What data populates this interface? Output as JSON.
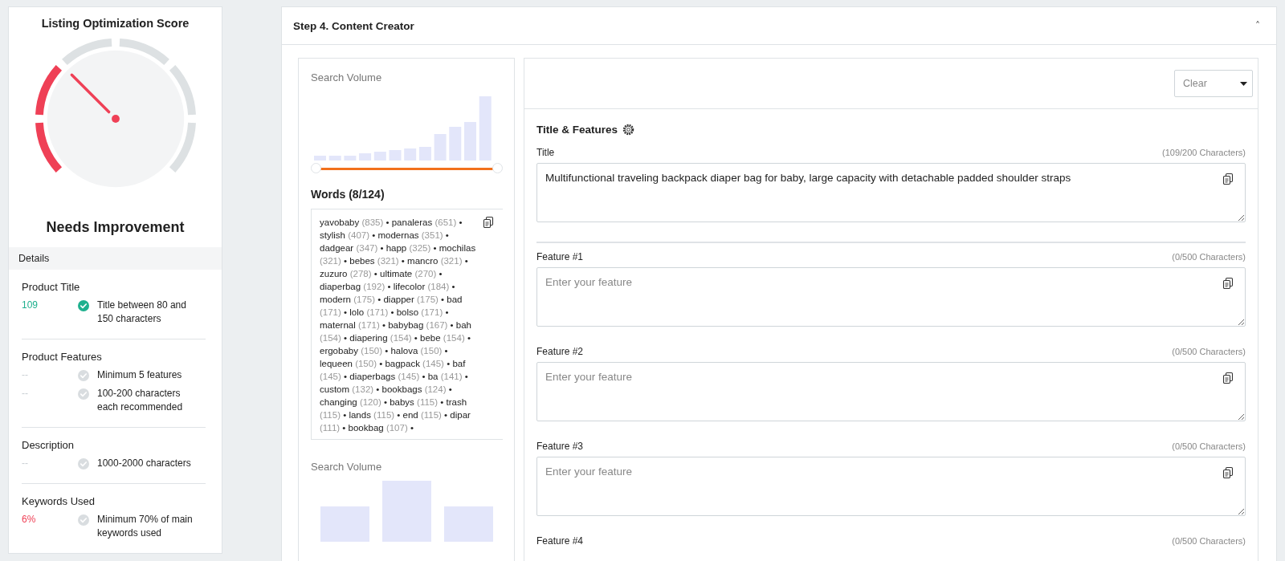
{
  "score_panel": {
    "title": "Listing Optimization Score",
    "gauge": {
      "segments": [
        {
          "filled": true
        },
        {
          "filled": true
        },
        {
          "filled": false
        },
        {
          "filled": false
        },
        {
          "filled": false
        },
        {
          "filled": false
        }
      ]
    },
    "verdict": "Needs Improvement",
    "details_heading": "Details",
    "groups": [
      {
        "title": "Product Title",
        "rows": [
          {
            "value": "109",
            "color": "#1fb08e",
            "checked": true,
            "requirement": "Title between 80 and 150 characters"
          }
        ]
      },
      {
        "title": "Product Features",
        "rows": [
          {
            "value": "--",
            "color": "#c9ced3",
            "checked": false,
            "requirement": "Minimum 5 features"
          },
          {
            "value": "--",
            "color": "#c9ced3",
            "checked": false,
            "requirement": "100-200 characters each recommended"
          }
        ]
      },
      {
        "title": "Description",
        "rows": [
          {
            "value": "--",
            "color": "#c9ced3",
            "checked": false,
            "requirement": "1000-2000 characters"
          }
        ]
      },
      {
        "title": "Keywords Used",
        "rows": [
          {
            "value": "6%",
            "color": "#ef4056",
            "checked": false,
            "requirement": "Minimum 70% of main keywords used"
          }
        ]
      }
    ]
  },
  "step": {
    "title": "Step 4. Content Creator",
    "expanded": true,
    "chevron": "˄"
  },
  "keywords_panel": {
    "chart_label": "Search Volume",
    "words_heading": "Words (8/124)",
    "separator": "•",
    "second_chart_label": "Search Volume",
    "words": [
      {
        "word": "yavobaby",
        "count": "(835)"
      },
      {
        "word": "panaleras",
        "count": "(651)"
      },
      {
        "word": "stylish",
        "count": "(407)"
      },
      {
        "word": "modernas",
        "count": "(351)"
      },
      {
        "word": "dadgear",
        "count": "(347)"
      },
      {
        "word": "happ",
        "count": "(325)"
      },
      {
        "word": "mochilas",
        "count": "(321)"
      },
      {
        "word": "bebes",
        "count": "(321)"
      },
      {
        "word": "mancro",
        "count": "(321)"
      },
      {
        "word": "zuzuro",
        "count": "(278)"
      },
      {
        "word": "ultimate",
        "count": "(270)"
      },
      {
        "word": "diaperbag",
        "count": "(192)"
      },
      {
        "word": "lifecolor",
        "count": "(184)"
      },
      {
        "word": "modern",
        "count": "(175)"
      },
      {
        "word": "diapper",
        "count": "(175)"
      },
      {
        "word": "bad",
        "count": "(171)"
      },
      {
        "word": "lolo",
        "count": "(171)"
      },
      {
        "word": "bolso",
        "count": "(171)"
      },
      {
        "word": "maternal",
        "count": "(171)"
      },
      {
        "word": "babybag",
        "count": "(167)"
      },
      {
        "word": "bah",
        "count": "(154)"
      },
      {
        "word": "diapering",
        "count": "(154)"
      },
      {
        "word": "bebe",
        "count": "(154)"
      },
      {
        "word": "ergobaby",
        "count": "(150)"
      },
      {
        "word": "halova",
        "count": "(150)"
      },
      {
        "word": "lequeen",
        "count": "(150)"
      },
      {
        "word": "bagpack",
        "count": "(145)"
      },
      {
        "word": "baf",
        "count": "(145)"
      },
      {
        "word": "diaperbags",
        "count": "(145)"
      },
      {
        "word": "ba",
        "count": "(141)"
      },
      {
        "word": "custom",
        "count": "(132)"
      },
      {
        "word": "bookbags",
        "count": "(124)"
      },
      {
        "word": "changing",
        "count": "(120)"
      },
      {
        "word": "babys",
        "count": "(115)"
      },
      {
        "word": "trash",
        "count": "(115)"
      },
      {
        "word": "lands",
        "count": "(115)"
      },
      {
        "word": "end",
        "count": "(115)"
      },
      {
        "word": "dipar",
        "count": "(111)"
      },
      {
        "word": "bookbag",
        "count": "(107)"
      }
    ]
  },
  "editor": {
    "clear_dropdown": "Clear",
    "section_title": "Title & Features",
    "title_field": {
      "label": "Title",
      "counter": "(109/200 Characters)",
      "value": "Multifunctional traveling backpack diaper bag for baby, large capacity with detachable padded shoulder straps"
    },
    "features": [
      {
        "label": "Feature #1",
        "counter": "(0/500 Characters)",
        "placeholder": "Enter your feature"
      },
      {
        "label": "Feature #2",
        "counter": "(0/500 Characters)",
        "placeholder": "Enter your feature"
      },
      {
        "label": "Feature #3",
        "counter": "(0/500 Characters)",
        "placeholder": "Enter your feature"
      },
      {
        "label": "Feature #4",
        "counter": "(0/500 Characters)"
      }
    ]
  }
}
